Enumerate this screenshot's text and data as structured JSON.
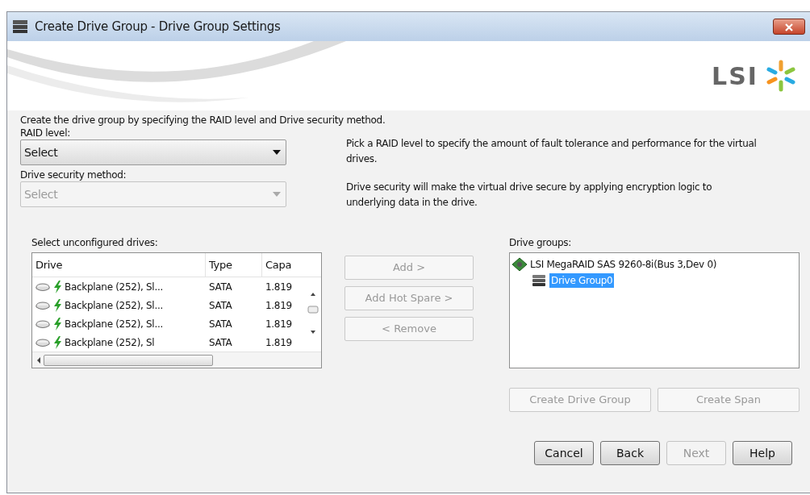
{
  "window": {
    "title": "Create Drive Group - Drive Group Settings"
  },
  "logo": {
    "text": "LSI"
  },
  "intro": "Create the drive group by specifying the RAID level and Drive security method.",
  "fields": [
    {
      "label": "RAID level:",
      "value": "Select",
      "disabled": false,
      "hint": "Pick a RAID level to specify the amount of fault tolerance and performance for the virtual drives."
    },
    {
      "label": "Drive security method:",
      "value": "Select",
      "disabled": true,
      "hint": "Drive security will make the virtual drive secure by applying encryption logic to underlying data in the drive."
    }
  ],
  "drives": {
    "label": "Select unconfigured drives:",
    "columns": [
      "Drive",
      "Type",
      "Capa"
    ],
    "rows": [
      {
        "drive": "Backplane (252), Sl...",
        "type": "SATA",
        "capacity": "1.819"
      },
      {
        "drive": "Backplane (252), Sl...",
        "type": "SATA",
        "capacity": "1.819"
      },
      {
        "drive": "Backplane (252), Sl...",
        "type": "SATA",
        "capacity": "1.819"
      },
      {
        "drive": "Backplane (252), Sl",
        "type": "SATA",
        "capacity": "1.819"
      }
    ]
  },
  "move_buttons": [
    {
      "label": "Add >",
      "disabled": true
    },
    {
      "label": "Add Hot Spare >",
      "disabled": true
    },
    {
      "label": "< Remove",
      "disabled": true
    }
  ],
  "drive_groups": {
    "label": "Drive groups:",
    "tree": [
      {
        "label": "LSI MegaRAID SAS 9260-8i(Bus 3,Dev 0)",
        "selected": false,
        "children": [
          {
            "label": "Drive Group0",
            "selected": true
          }
        ]
      }
    ]
  },
  "group_buttons": [
    {
      "label": "Create Drive Group",
      "disabled": true
    },
    {
      "label": "Create Span",
      "disabled": true
    }
  ],
  "footer_buttons": [
    {
      "label": "Cancel",
      "disabled": false
    },
    {
      "label": "Back",
      "disabled": false
    },
    {
      "label": "Next",
      "disabled": true
    },
    {
      "label": "Help",
      "disabled": false
    }
  ]
}
